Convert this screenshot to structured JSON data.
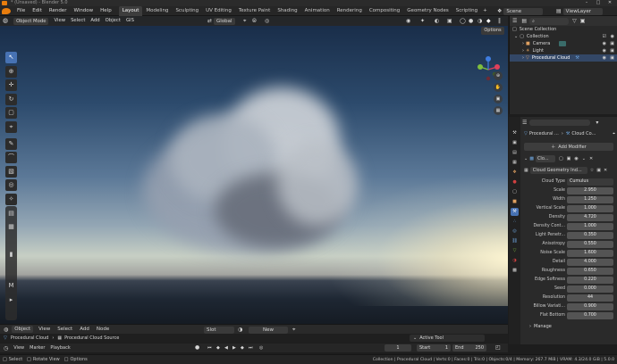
{
  "window": {
    "title": "* (Unsaved) - Blender 5.0",
    "minimize": "–",
    "maximize": "□",
    "close": "✕"
  },
  "menu": [
    "File",
    "Edit",
    "Render",
    "Window",
    "Help"
  ],
  "workspaces": [
    "Layout",
    "Modeling",
    "Sculpting",
    "UV Editing",
    "Texture Paint",
    "Shading",
    "Animation",
    "Rendering",
    "Compositing",
    "Geometry Nodes",
    "Scripting"
  ],
  "active_workspace": "Layout",
  "scene": {
    "name": "Scene",
    "view_layer": "ViewLayer"
  },
  "viewport_header": {
    "mode": "Object Mode",
    "menus": [
      "View",
      "Select",
      "Add",
      "Object",
      "GIS"
    ],
    "transform": "Global",
    "options": "Options"
  },
  "gizmo": {
    "x": "X",
    "y": "Y",
    "z": "Z"
  },
  "outliner": {
    "root": "Scene Collection",
    "collection": "Collection",
    "items": [
      {
        "name": "Camera",
        "icon": "camera-icon"
      },
      {
        "name": "Light",
        "icon": "light-icon"
      },
      {
        "name": "Procedural Cloud",
        "icon": "mesh-icon"
      }
    ]
  },
  "properties": {
    "object_name": "Procedural ...",
    "modifier_path": "Cloud Co...",
    "add_modifier": "Add Modifier",
    "modifier_short": "Clo...",
    "node_group": "Cloud Geometry Ind...",
    "cloud_type_label": "Cloud Type",
    "cloud_type_value": "Cumulus",
    "params": [
      {
        "label": "Scale",
        "value": "2.950"
      },
      {
        "label": "Width",
        "value": "1.250"
      },
      {
        "label": "Vertical Scale",
        "value": "1.000"
      },
      {
        "label": "Density",
        "value": "4.720"
      },
      {
        "label": "Density Cont...",
        "value": "1.000"
      },
      {
        "label": "Light Penetr...",
        "value": "0.350"
      },
      {
        "label": "Anisotropy",
        "value": "0.550"
      },
      {
        "label": "Noise Scale",
        "value": "1.600"
      },
      {
        "label": "Detail",
        "value": "4.000"
      },
      {
        "label": "Roughness",
        "value": "0.650"
      },
      {
        "label": "Edge Softness",
        "value": "0.220"
      },
      {
        "label": "Seed",
        "value": "0.000"
      },
      {
        "label": "Resolution",
        "value": "44"
      },
      {
        "label": "Billow Variati...",
        "value": "0.900"
      },
      {
        "label": "Flat Bottom",
        "value": "0.700"
      }
    ],
    "manage": "Manage"
  },
  "timeline": {
    "editor": "Object",
    "menus": [
      "View",
      "Select",
      "Add",
      "Node"
    ],
    "slot": "Slot",
    "new": "New",
    "breadcrumb_1": "Procedural Cloud",
    "breadcrumb_2": "Procedural Cloud Source",
    "active_tool": "Active Tool",
    "play_menus": [
      "View",
      "Marker",
      "Playback"
    ],
    "current_frame": "1",
    "start_label": "Start",
    "start": "1",
    "end_label": "End",
    "end": "250"
  },
  "status": {
    "left": [
      "Select",
      "Rotate View",
      "Options"
    ],
    "right": "Collection | Procedural Cloud | Verts:0 | Faces:0 | Tris:0 | Objects:0/4 | Memory: 267.7 MiB | VRAM: 4.3/24.0 GiB | 5.0.0"
  },
  "colors": {
    "accent": "#4772b3",
    "selection": "#334766",
    "header": "#262626"
  }
}
